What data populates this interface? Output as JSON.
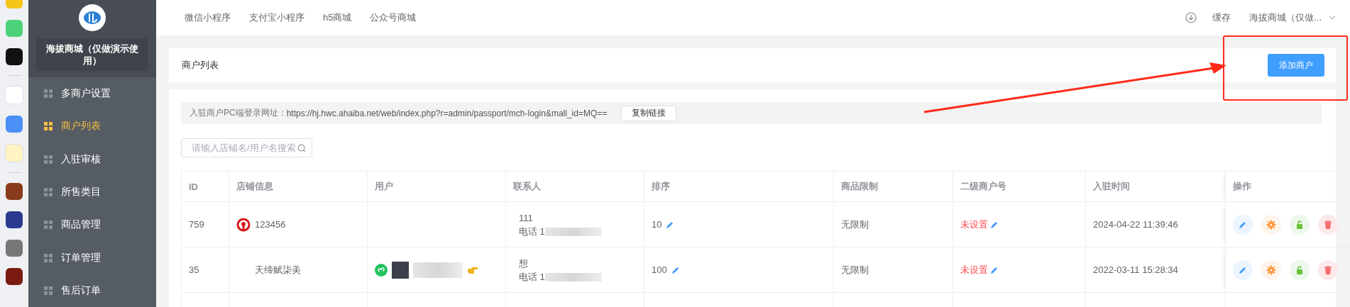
{
  "sidebar": {
    "title": "海拔商城（仅做演示使用）",
    "items": [
      {
        "label": "多商户设置",
        "selected": false
      },
      {
        "label": "商户列表",
        "selected": true
      },
      {
        "label": "入驻审核",
        "selected": false
      },
      {
        "label": "所售类目",
        "selected": false
      },
      {
        "label": "商品管理",
        "selected": false
      },
      {
        "label": "订单管理",
        "selected": false
      },
      {
        "label": "售后订单",
        "selected": false
      }
    ]
  },
  "top_nav": {
    "tabs": [
      "微信小程序",
      "支付宝小程序",
      "h5商城",
      "公众号商城"
    ],
    "cache": "缓存",
    "account": "海拔商城（仅做..."
  },
  "page_header": {
    "title": "商户列表",
    "button": "添加商户"
  },
  "login_url": {
    "label": "入驻商户PC端登录网址：",
    "url": "https://hj.hwc.ahaiba.net/web/index.php?r=admin/passport/mch-login&mall_id=MQ==",
    "button": "复制链接"
  },
  "search": {
    "placeholder": "请输入店铺名/用户名搜索"
  },
  "table": {
    "columns": [
      "ID",
      "店铺信息",
      "用户",
      "联系人",
      "排序",
      "商品限制",
      "二级商户号",
      "入驻时间",
      "操作"
    ],
    "rows": [
      {
        "id": "759",
        "store": "123456",
        "store_logo": true,
        "user_wechat": false,
        "contact": [
          "111",
          "电话 1"
        ],
        "sort": "10",
        "limit": "无限制",
        "sub_merchant": "未设置",
        "time": "2024-04-22 11:39:46"
      },
      {
        "id": "35",
        "store": "天缔赋柒美",
        "store_logo": false,
        "user_wechat": true,
        "contact": [
          "想",
          "电话 1"
        ],
        "sort": "100",
        "limit": "无限制",
        "sub_merchant": "未设置",
        "time": "2022-03-11 15:28:34"
      }
    ]
  }
}
